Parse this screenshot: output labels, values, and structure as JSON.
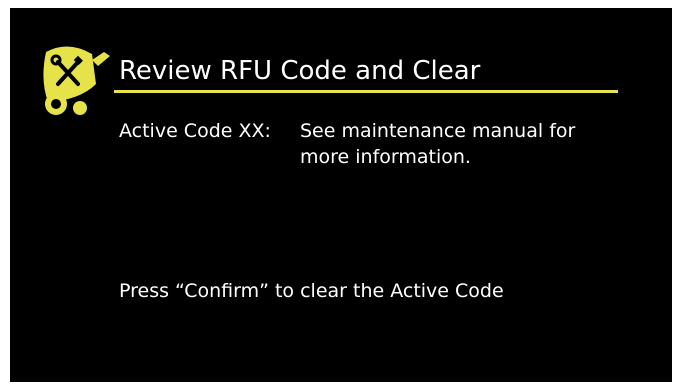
{
  "header": {
    "title": "Review RFU Code and Clear",
    "icon": "maintenance-robot-icon"
  },
  "fault": {
    "label": "Active Code XX:",
    "description": "See maintenance manual for more information."
  },
  "prompt": {
    "text": "Press “Confirm” to clear the Active Code"
  },
  "colors": {
    "background": "#000000",
    "accent": "#e6e34a",
    "text": "#ffffff"
  }
}
